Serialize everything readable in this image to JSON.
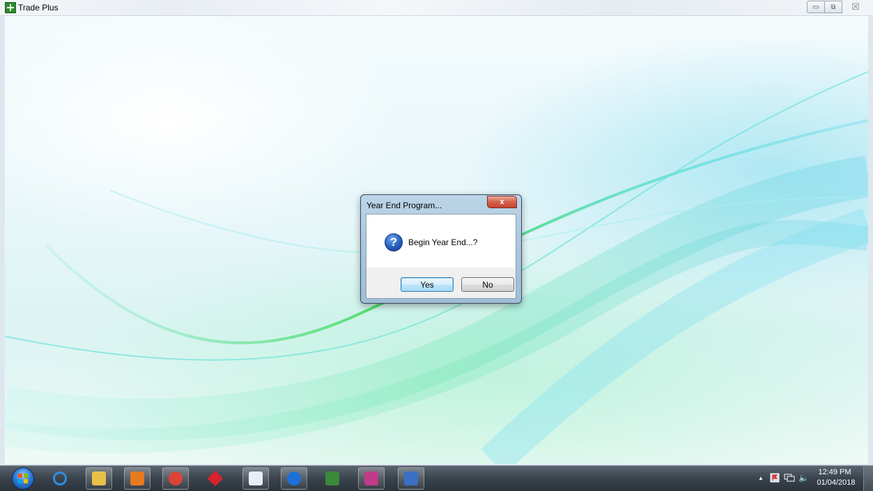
{
  "app": {
    "title": "Trade Plus",
    "controls": {
      "minimize": "▭",
      "restore": "⧉",
      "close": "☒"
    }
  },
  "dialog": {
    "title": "Year End Program...",
    "close_label": "x",
    "message": "Begin Year End...?",
    "icon": "question-icon",
    "question_glyph": "?",
    "buttons": {
      "yes": "Yes",
      "no": "No"
    }
  },
  "taskbar": {
    "pinned": [
      {
        "name": "internet-explorer-icon",
        "color": "#2f8fe0"
      },
      {
        "name": "file-explorer-icon",
        "color": "#e8c04a"
      },
      {
        "name": "media-player-icon",
        "color": "#e87a1e"
      },
      {
        "name": "chrome-icon",
        "color": "#db4437"
      },
      {
        "name": "red-diamond-app-icon",
        "color": "#d8222c"
      },
      {
        "name": "window-app-icon",
        "color": "#e8eef4"
      },
      {
        "name": "teamviewer-icon",
        "color": "#1e6fd8"
      },
      {
        "name": "spreadsheet-app-icon",
        "color": "#3a8a3a"
      },
      {
        "name": "paint-app-icon",
        "color": "#c23a8a"
      },
      {
        "name": "remote-desktop-icon",
        "color": "#3b6fc4"
      }
    ],
    "tray": {
      "show_hidden": "▲",
      "flag_icon": "action-center-icon",
      "network_icon": "network-icon",
      "volume_icon": "volume-icon",
      "volume_glyph": "🔈",
      "time": "12:49 PM",
      "date": "01/04/2018"
    }
  }
}
